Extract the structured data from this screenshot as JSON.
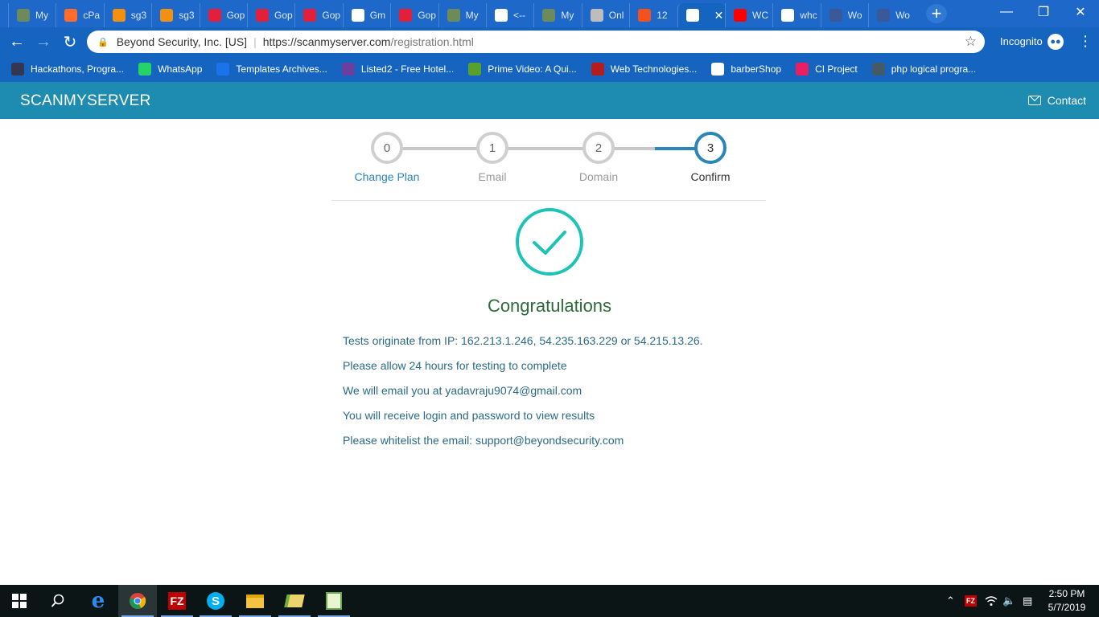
{
  "browser": {
    "tabs": [
      {
        "label": "My",
        "fav": "person-icon",
        "color": "#6d8a5b"
      },
      {
        "label": "cPa",
        "fav": "cpanel-icon",
        "color": "#ff6c2c"
      },
      {
        "label": "sg3",
        "fav": "phpmyadmin-icon",
        "color": "#f29111"
      },
      {
        "label": "sg3",
        "fav": "phpmyadmin-icon",
        "color": "#f29111"
      },
      {
        "label": "Gop",
        "fav": "godaddy-icon",
        "color": "#e2203b"
      },
      {
        "label": "Gop",
        "fav": "godaddy-icon",
        "color": "#e2203b"
      },
      {
        "label": "Gop",
        "fav": "godaddy-icon",
        "color": "#e2203b"
      },
      {
        "label": "Gm",
        "fav": "gmail-icon",
        "color": "#ffffff"
      },
      {
        "label": "Gop",
        "fav": "godaddy-icon",
        "color": "#e2203b"
      },
      {
        "label": "My",
        "fav": "person-icon",
        "color": "#6d8a5b"
      },
      {
        "label": "<--",
        "fav": "google-icon",
        "color": "#ffffff"
      },
      {
        "label": "My",
        "fav": "person-icon",
        "color": "#6d8a5b"
      },
      {
        "label": "Onl",
        "fav": "globe-icon",
        "color": "#bdbdbd"
      },
      {
        "label": "12",
        "fav": "code-icon",
        "color": "#f4511e"
      },
      {
        "label": "",
        "fav": "globe-icon",
        "color": "#ffffff",
        "active": true
      },
      {
        "label": "WC",
        "fav": "youtube-icon",
        "color": "#ff0000"
      },
      {
        "label": "whc",
        "fav": "google-icon",
        "color": "#ffffff"
      },
      {
        "label": "Wo",
        "fav": "facebook-icon",
        "color": "#3b5998"
      },
      {
        "label": "Wo",
        "fav": "facebook-icon",
        "color": "#3b5998"
      }
    ],
    "close_tab": "✕",
    "new_tab": "+",
    "window_controls": [
      "—",
      "❐",
      "✕"
    ],
    "site_identity": "Beyond Security, Inc. [US]",
    "url_host": "https://scanmyserver.com",
    "url_path": "/registration.html",
    "incognito_label": "Incognito",
    "bookmarks": [
      {
        "label": "Hackathons, Progra...",
        "fav": "hackerearth-icon",
        "color": "#323754"
      },
      {
        "label": "WhatsApp",
        "fav": "whatsapp-icon",
        "color": "#25d366"
      },
      {
        "label": "Templates Archives...",
        "fav": "c-icon",
        "color": "#1a73e8"
      },
      {
        "label": "Listed2 - Free Hotel...",
        "fav": "colorlib-icon",
        "color": "#6a3fa0"
      },
      {
        "label": "Prime Video: A Qui...",
        "fav": "play-icon",
        "color": "#5aa02c"
      },
      {
        "label": "Web Technologies...",
        "fav": "w-icon",
        "color": "#b71c1c"
      },
      {
        "label": "barberShop",
        "fav": "pinwheel-icon",
        "color": "#ffffff"
      },
      {
        "label": "CI Project",
        "fav": "ci-icon",
        "color": "#e91e63"
      },
      {
        "label": "php logical progra...",
        "fav": "php-icon",
        "color": "#455a64"
      }
    ]
  },
  "site": {
    "brand": "SCANMYSERVER",
    "contact": "Contact",
    "steps": [
      {
        "number": "0",
        "label": "Change Plan"
      },
      {
        "number": "1",
        "label": "Email"
      },
      {
        "number": "2",
        "label": "Domain"
      },
      {
        "number": "3",
        "label": "Confirm"
      }
    ],
    "current_step": 3,
    "title": "Congratulations",
    "messages": [
      "Tests originate from IP: 162.213.1.246, 54.235.163.229 or 54.215.13.26.",
      "Please allow 24 hours for testing to complete",
      "We will email you at yadavraju9074@gmail.com",
      "You will receive login and password to view results",
      "Please whitelist the email: support@beyondsecurity.com"
    ]
  },
  "colors": {
    "tabstrip": "#1d68c8",
    "toolbar": "#1565c0",
    "header": "#1e8bb0",
    "step_active": "#2a86b8",
    "check": "#1cc4b8",
    "title": "#2f6b3a",
    "text": "#2b6a86"
  },
  "taskbar": {
    "time": "2:50 PM",
    "date": "5/7/2019"
  }
}
